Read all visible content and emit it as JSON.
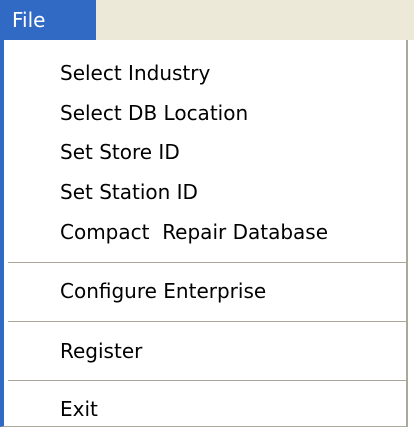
{
  "menubar": {
    "title": "File"
  },
  "menu": {
    "items": [
      {
        "label": "Select Industry"
      },
      {
        "label": "Select DB Location"
      },
      {
        "label": "Set Store ID"
      },
      {
        "label": "Set Station ID"
      },
      {
        "label": "Compact  Repair Database"
      },
      {
        "label": "Configure Enterprise"
      },
      {
        "label": "Register"
      },
      {
        "label": "Exit"
      }
    ]
  },
  "colors": {
    "highlight": "#316ac5",
    "menubar_bg": "#ece9d8",
    "separator": "#aca899"
  }
}
